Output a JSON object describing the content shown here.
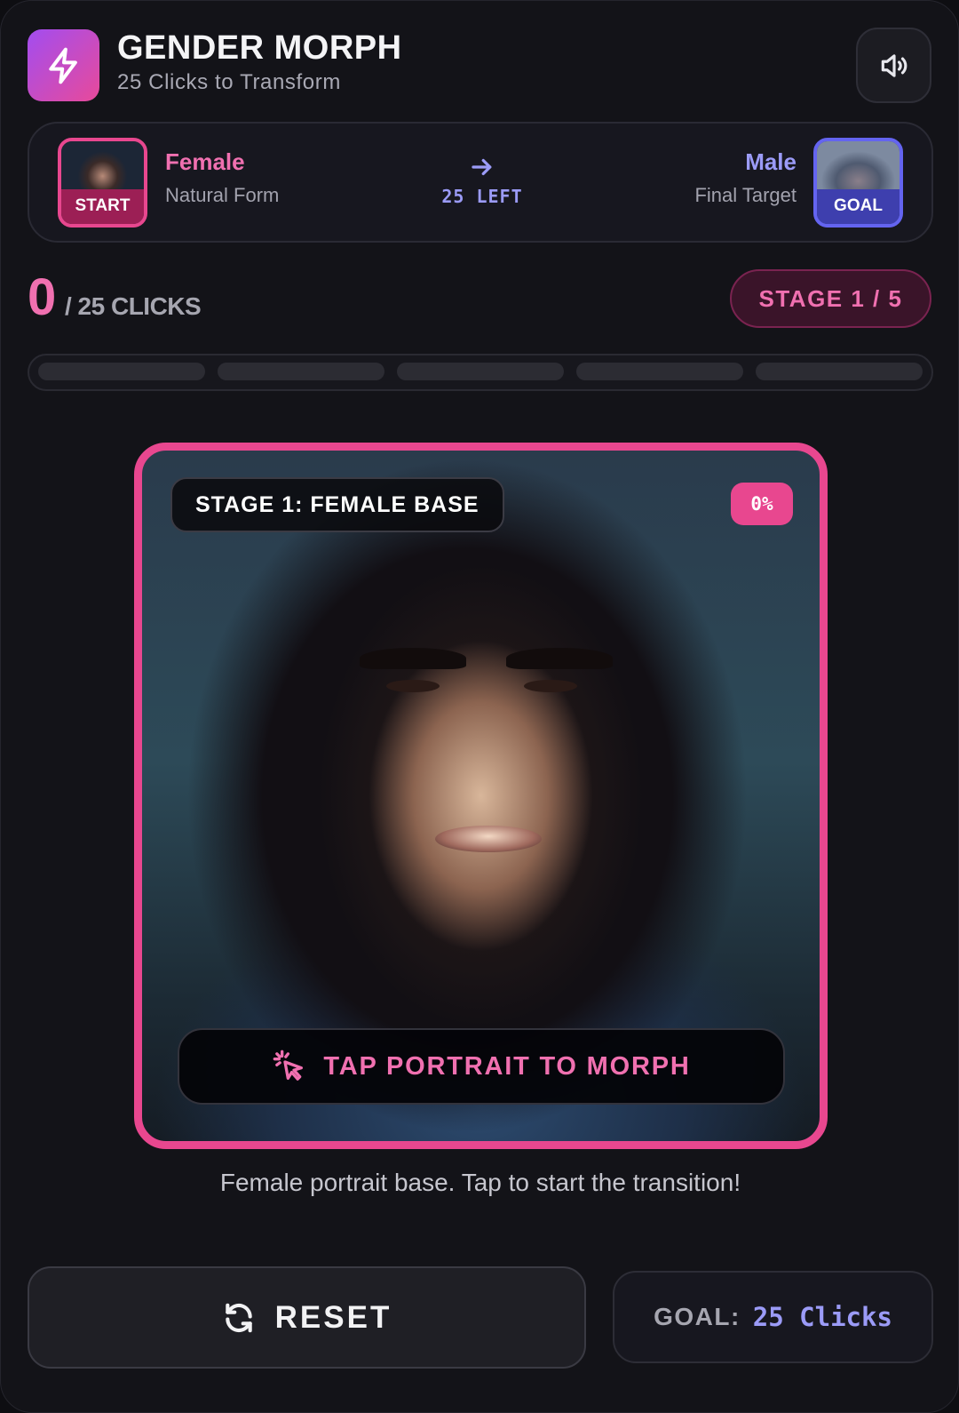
{
  "header": {
    "title": "GENDER MORPH",
    "subtitle": "25 Clicks to Transform",
    "logo_icon": "lightning-bolt-icon",
    "sound_icon": "speaker-volume-icon"
  },
  "transform": {
    "start_tag": "START",
    "from_title": "Female",
    "from_sub": "Natural Form",
    "left_label": "25  LEFT",
    "to_title": "Male",
    "to_sub": "Final Target",
    "goal_tag": "GOAL"
  },
  "progress": {
    "clicks": "0",
    "total_label": "/ 25 CLICKS",
    "stage_label": "STAGE 1 / 5",
    "segments_filled": 0,
    "segments_total": 5
  },
  "portrait": {
    "stage_name": "STAGE 1: FEMALE BASE",
    "percent": "0%",
    "tap_label": "TAP PORTRAIT TO MORPH"
  },
  "caption": "Female portrait base. Tap to start the transition!",
  "footer": {
    "reset_label": "RESET",
    "goal_label": "GOAL:",
    "goal_value": "25 Clicks"
  },
  "colors": {
    "accent_pink": "#e8478f",
    "accent_violet": "#9b9bf7",
    "background": "#131318"
  }
}
